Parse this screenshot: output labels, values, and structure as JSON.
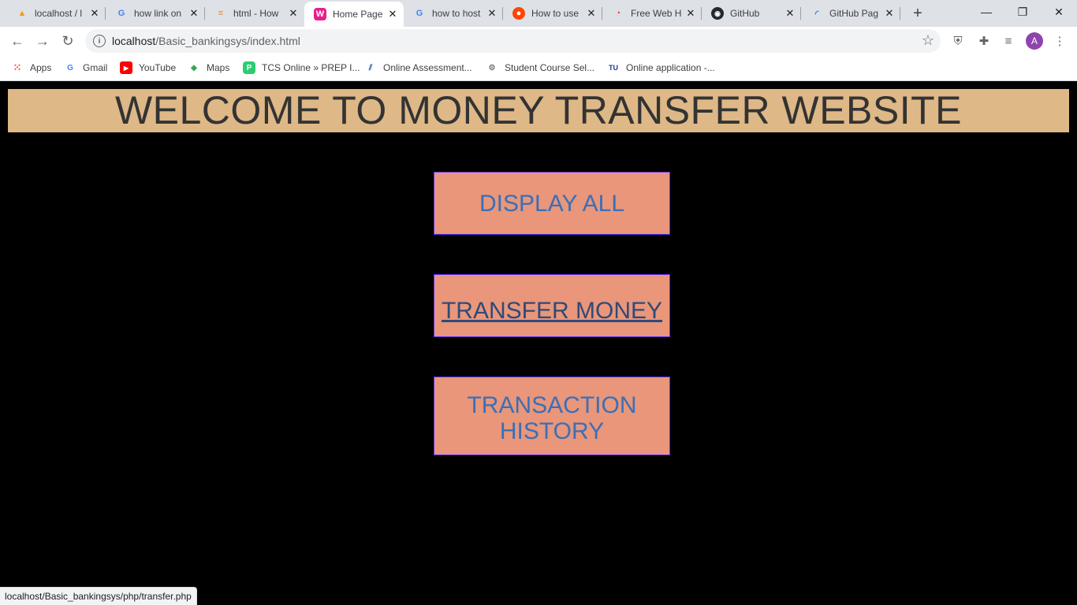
{
  "tabs": [
    {
      "title": "localhost / l",
      "icon": "phpmyadmin-icon"
    },
    {
      "title": "how link on",
      "icon": "google-icon"
    },
    {
      "title": "html - How",
      "icon": "stackoverflow-icon"
    },
    {
      "title": "Home Page",
      "icon": "wamp-icon"
    },
    {
      "title": "how to host",
      "icon": "google-icon"
    },
    {
      "title": "How to use",
      "icon": "reddit-icon"
    },
    {
      "title": "Free Web H",
      "icon": "webhost-icon"
    },
    {
      "title": "GitHub",
      "icon": "github-icon"
    },
    {
      "title": "GitHub Pag",
      "icon": "loading-spinner-icon"
    }
  ],
  "address": {
    "host": "localhost",
    "path": "/Basic_bankingsys/index.html"
  },
  "profile": {
    "initial": "A"
  },
  "bookmarks": [
    {
      "label": "Apps",
      "icon": "apps-grid-icon"
    },
    {
      "label": "Gmail",
      "icon": "google-icon"
    },
    {
      "label": "YouTube",
      "icon": "youtube-icon"
    },
    {
      "label": "Maps",
      "icon": "maps-icon"
    },
    {
      "label": "TCS Online » PREP I...",
      "icon": "tcs-icon"
    },
    {
      "label": "Online Assessment...",
      "icon": "assessment-icon"
    },
    {
      "label": "Student Course Sel...",
      "icon": "university-icon"
    },
    {
      "label": "Online application -...",
      "icon": "tu-icon"
    }
  ],
  "page": {
    "heading": "WELCOME TO MONEY TRANSFER WEBSITE",
    "buttons": {
      "display_all": "DISPLAY ALL",
      "transfer_money": "TRANSFER MONEY",
      "transaction_history_line1": "TRANSACTION",
      "transaction_history_line2": "HISTORY"
    }
  },
  "status_url": "localhost/Basic_bankingsys/php/transfer.php",
  "colors": {
    "banner_bg": "#deb887",
    "button_bg": "#e9967a",
    "button_text": "#3a6fb8",
    "page_bg": "#000000"
  }
}
